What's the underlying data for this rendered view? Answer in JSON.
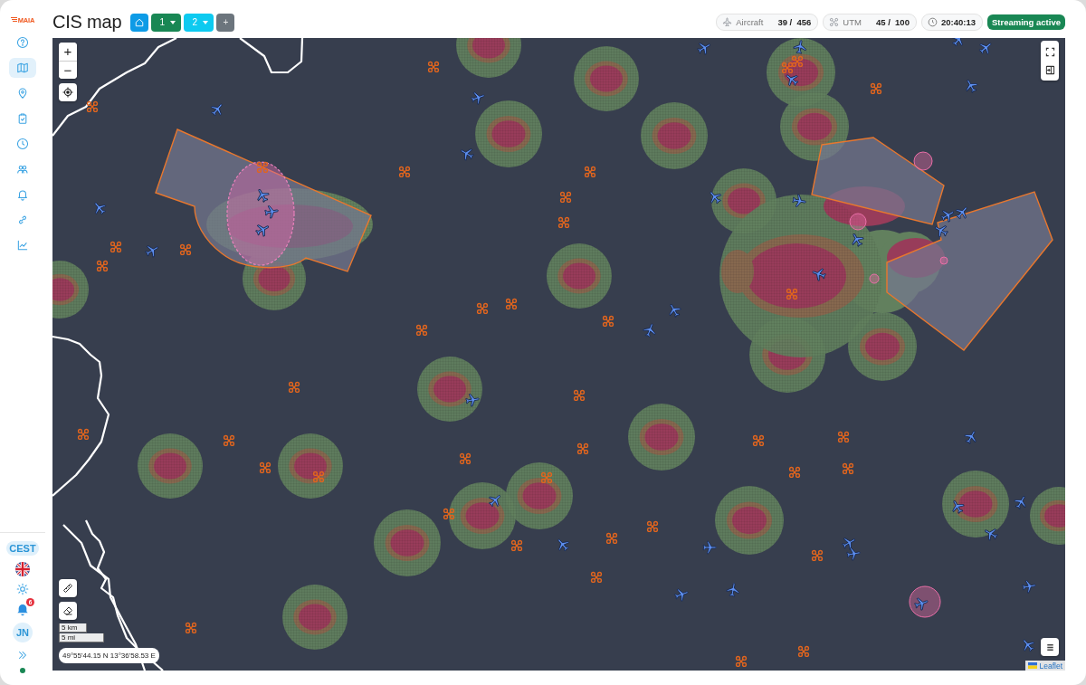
{
  "app": {
    "logo": "MAIA"
  },
  "sidebar": {
    "items": [
      {
        "selected": false
      },
      {
        "selected": true
      },
      {
        "selected": false
      },
      {
        "selected": false
      },
      {
        "selected": false
      },
      {
        "selected": false
      },
      {
        "selected": false
      },
      {
        "selected": false
      },
      {
        "selected": false
      }
    ],
    "timezone": "CEST",
    "notifications": {
      "count": "6"
    },
    "user": {
      "initials": "JN"
    }
  },
  "header": {
    "title": "CIS map",
    "layouts": [
      {
        "label": "1",
        "color": "#198754"
      },
      {
        "label": "2",
        "color": "#0dcaf0"
      }
    ],
    "add_button": "+",
    "stats": [
      {
        "label": "Aircraft",
        "value": "39 /  456"
      },
      {
        "label": "UTM",
        "value": "45 /  100"
      }
    ],
    "clock": "20:40:13",
    "status": "Streaming active"
  },
  "map": {
    "zoom_in": "+",
    "zoom_out": "−",
    "scale": [
      "5 km",
      "5 mi"
    ],
    "coordinates": "49°55'44.15 N 13°36'58.53 E",
    "attribution": "Leaflet"
  }
}
